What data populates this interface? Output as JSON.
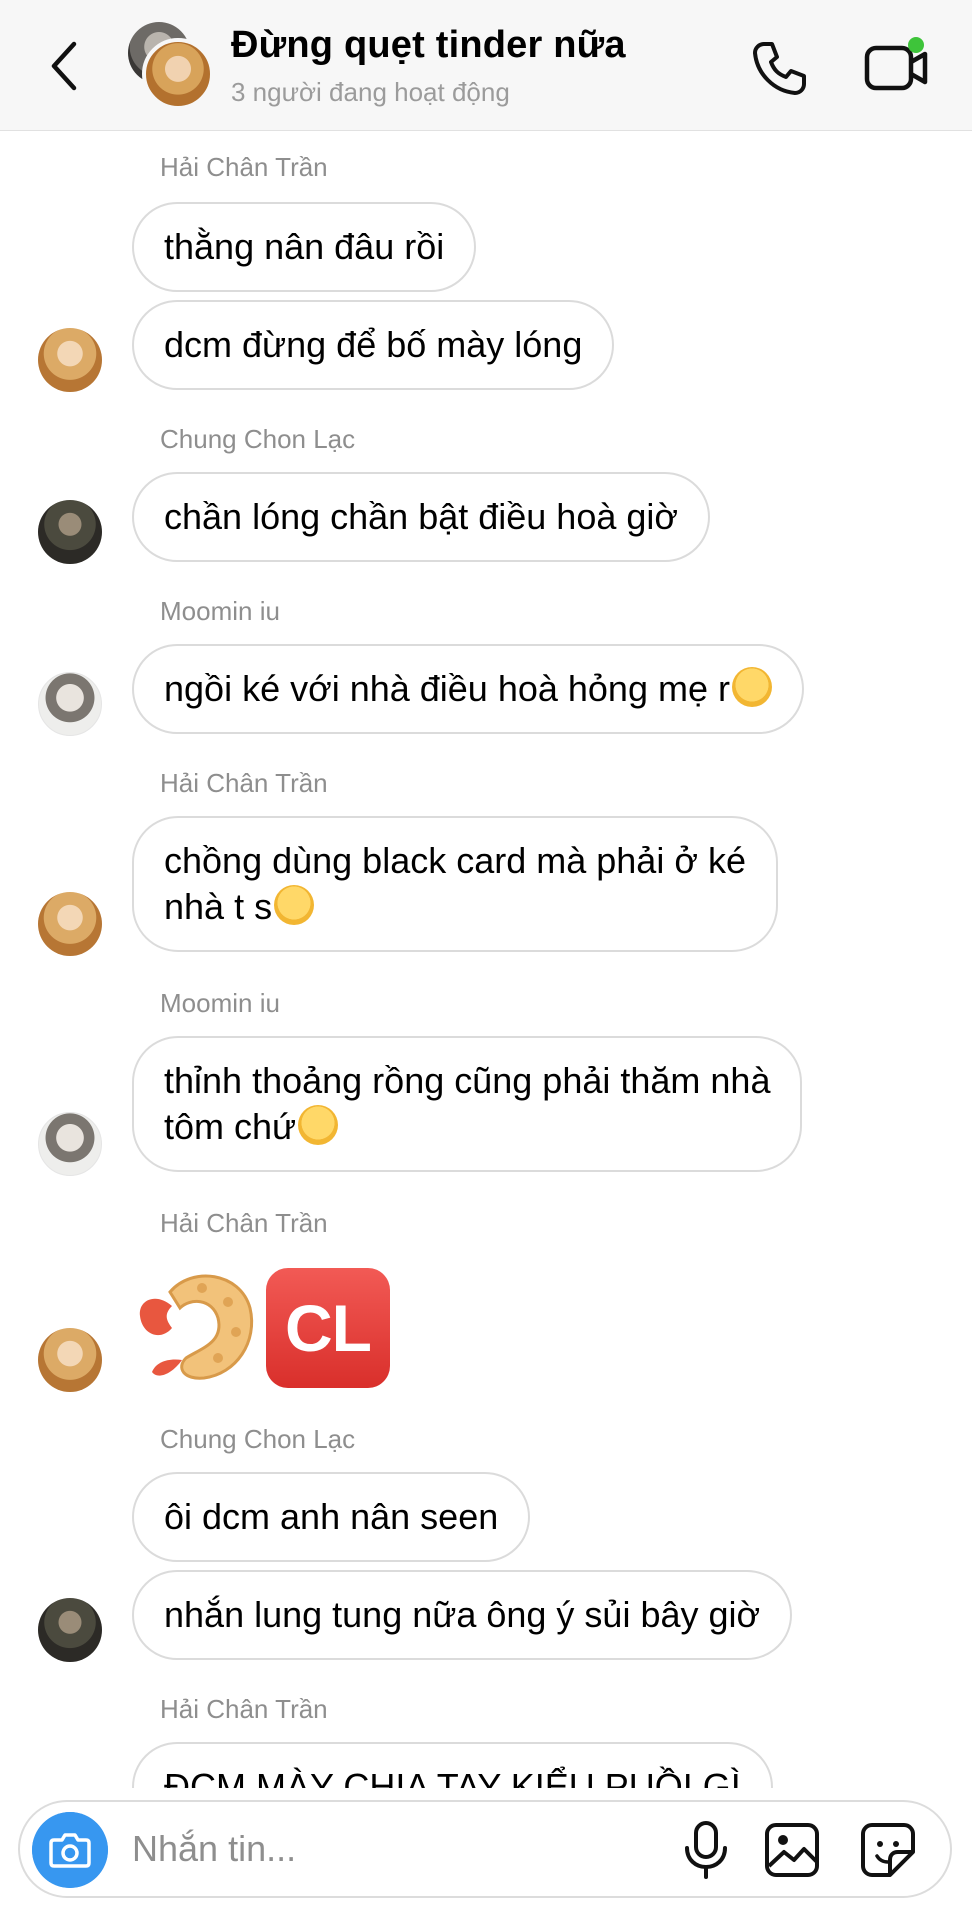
{
  "header": {
    "title": "Đừng quẹt tinder nữa",
    "status": "3 người đang hoạt động"
  },
  "messages": [
    {
      "sender": "Hải Chân Trần",
      "lines": [
        "thằng nân đâu rồi",
        "dcm đừng để bố mày lóng"
      ]
    },
    {
      "sender": "Chung Chon Lạc",
      "lines": [
        "chần lóng chần bật điều hoà giờ"
      ]
    },
    {
      "sender": "Moomin iu",
      "lines": [
        "ngồi ké với nhà điều hoà hỏng mẹ r"
      ]
    },
    {
      "sender": "Hải Chân Trần",
      "lines": [
        "chồng dùng black card mà phải ở ké",
        "nhà t s"
      ]
    },
    {
      "sender": "Moomin iu",
      "lines": [
        "thỉnh thoảng rồng cũng phải thăm nhà",
        "tôm chứ"
      ]
    },
    {
      "sender": "Hải Chân Trần",
      "sticker_label": "CL"
    },
    {
      "sender": "Chung Chon Lạc",
      "lines": [
        "ôi dcm anh nân seen",
        "nhắn lung tung nữa ông ý sủi bây giờ"
      ]
    },
    {
      "sender": "Hải Chân Trần",
      "lines": [
        "ĐCM MÀY CHIA TAY KIỂU PUỒI GÌ"
      ]
    }
  ],
  "composer": {
    "placeholder": "Nhắn tin..."
  },
  "icons": {
    "back": "chevron-left-icon",
    "call": "phone-icon",
    "video": "video-call-icon",
    "camera": "camera-icon",
    "mic": "microphone-icon",
    "gallery": "gallery-icon",
    "sticker": "sticker-icon"
  },
  "colors": {
    "accent_blue": "#3797f0",
    "online_green": "#3ec43a",
    "bubble_border": "#dbdbdb"
  }
}
